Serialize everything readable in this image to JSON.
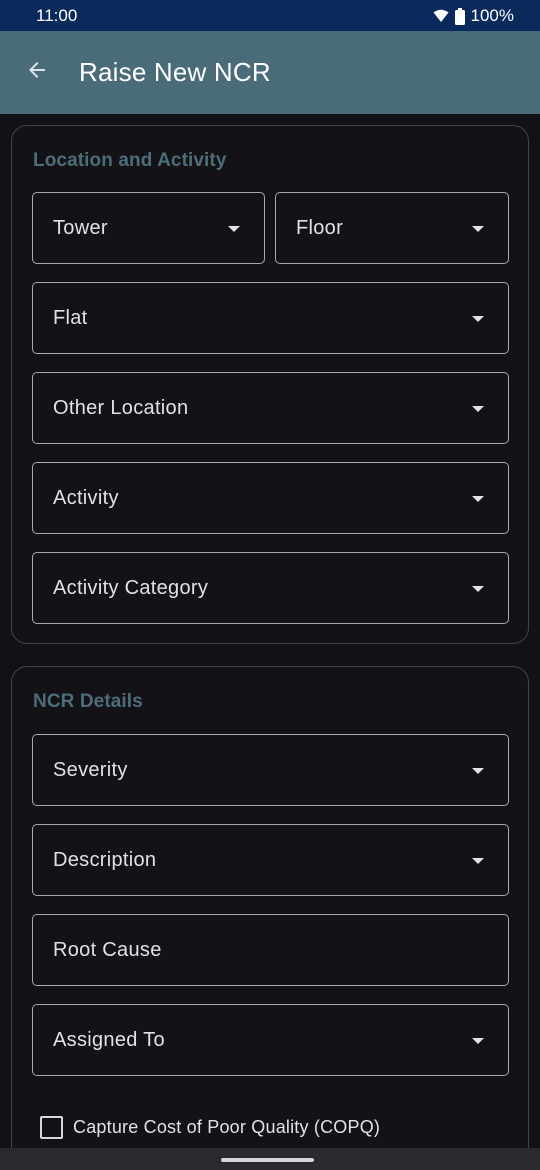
{
  "status_bar": {
    "time": "11:00",
    "battery": "100%"
  },
  "app_bar": {
    "title": "Raise New NCR",
    "back_icon": "arrow-left-icon"
  },
  "location_section": {
    "title": "Location and Activity",
    "fields": {
      "tower": "Tower",
      "floor": "Floor",
      "flat": "Flat",
      "other_location": "Other Location",
      "activity": "Activity",
      "activity_category": "Activity Category"
    }
  },
  "ncr_section": {
    "title": "NCR Details",
    "fields": {
      "severity": "Severity",
      "description": "Description",
      "root_cause": "Root Cause",
      "assigned_to": "Assigned To"
    },
    "copq_checkbox_label": "Capture Cost of Poor Quality (COPQ)"
  },
  "colors": {
    "status_bar": "#0b2a5c",
    "app_bar": "#4a6c78",
    "background": "#121116",
    "section_title": "#4e6d7a"
  }
}
